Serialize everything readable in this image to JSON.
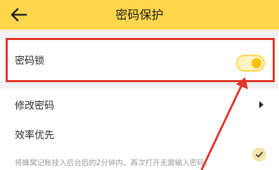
{
  "header": {
    "title": "密码保护",
    "back_icon": "back-arrow-icon",
    "background": "#ffd64c"
  },
  "settings": {
    "password_lock": {
      "label": "密码锁",
      "enabled": true
    },
    "change_password": {
      "label": "修改密码",
      "icon": "chevron-right-icon"
    },
    "efficiency_first": {
      "label": "效率优先",
      "hint": "将蜂窝记账挂入后台后的2分钟内，再次打开无需输入密码。",
      "checked": true
    }
  },
  "annotation": {
    "color": "#e0362c"
  }
}
